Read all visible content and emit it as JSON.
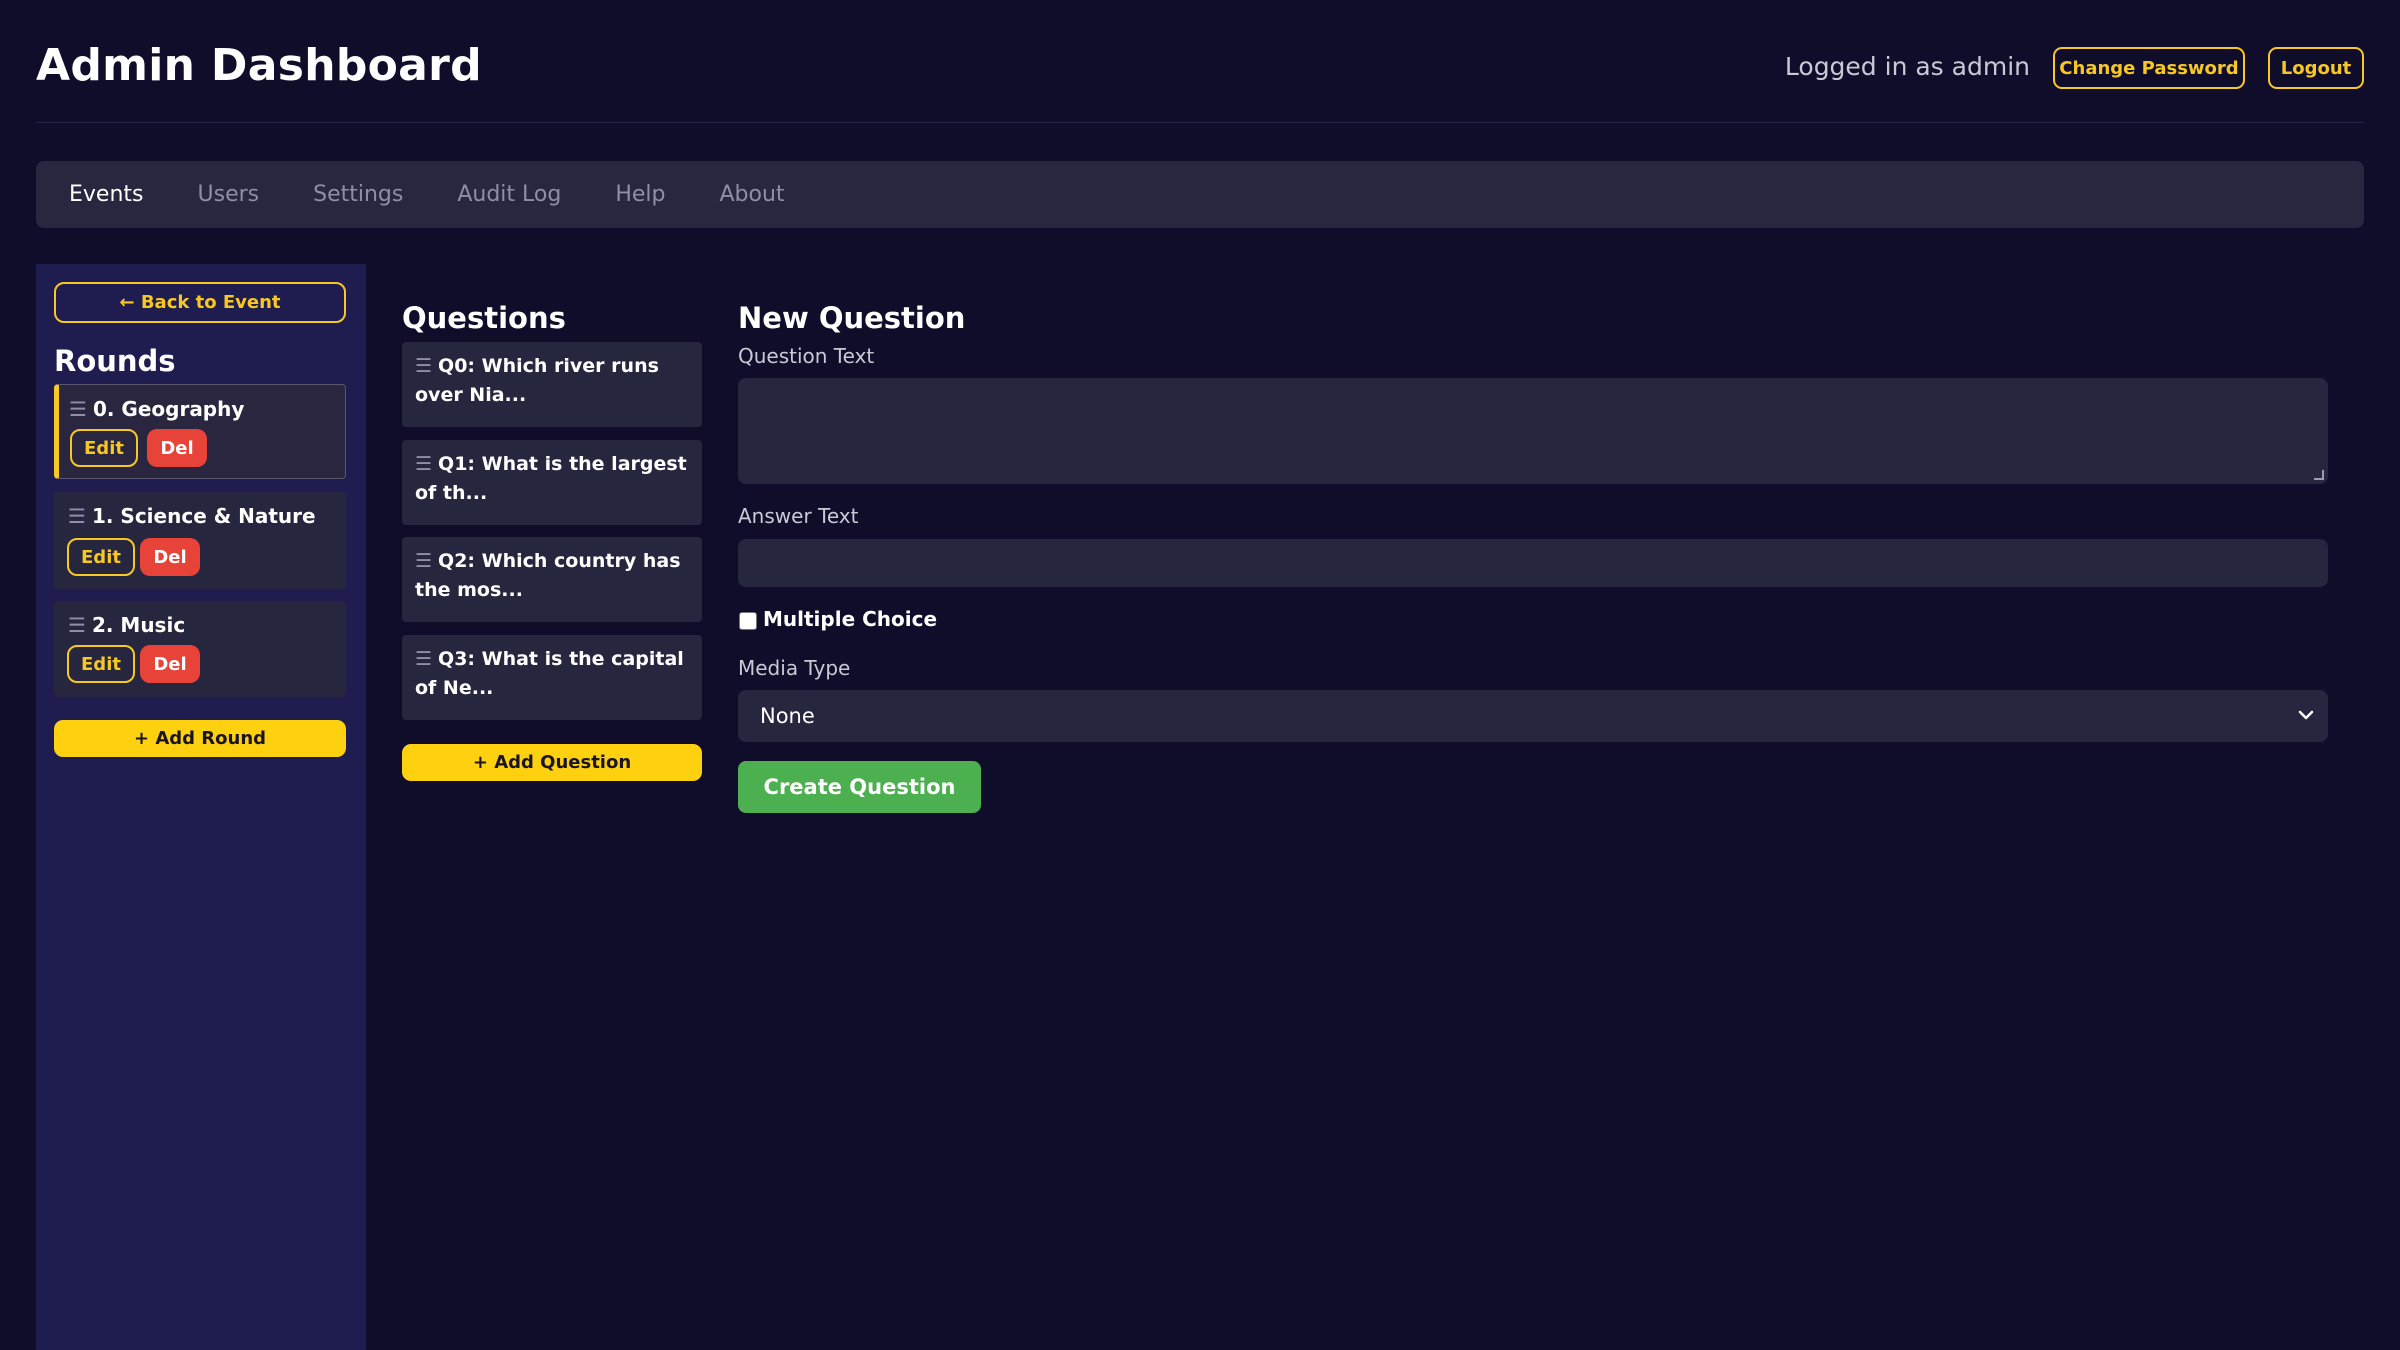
{
  "header": {
    "title": "Admin Dashboard",
    "logged_in_text": "Logged in as admin",
    "change_password_label": "Change Password",
    "logout_label": "Logout"
  },
  "nav": {
    "tabs": [
      {
        "label": "Events",
        "active": true
      },
      {
        "label": "Users",
        "active": false
      },
      {
        "label": "Settings",
        "active": false
      },
      {
        "label": "Audit Log",
        "active": false
      },
      {
        "label": "Help",
        "active": false
      },
      {
        "label": "About",
        "active": false
      }
    ]
  },
  "sidebar": {
    "back_label": "← Back to Event",
    "rounds_heading": "Rounds",
    "rounds": [
      {
        "label": "0. Geography",
        "active": true,
        "edit_label": "Edit",
        "del_label": "Del"
      },
      {
        "label": "1. Science & Nature",
        "active": false,
        "edit_label": "Edit",
        "del_label": "Del"
      },
      {
        "label": "2. Music",
        "active": false,
        "edit_label": "Edit",
        "del_label": "Del"
      }
    ],
    "add_round_label": "+ Add Round"
  },
  "questions": {
    "heading": "Questions",
    "items": [
      {
        "label": "Q0: Which river runs over Nia..."
      },
      {
        "label": "Q1: What is the largest of th..."
      },
      {
        "label": "Q2: Which country has the mos..."
      },
      {
        "label": "Q3: What is the capital of Ne..."
      }
    ],
    "add_question_label": "+ Add Question"
  },
  "form": {
    "heading": "New Question",
    "question_text_label": "Question Text",
    "question_text_value": "",
    "answer_text_label": "Answer Text",
    "answer_text_value": "",
    "multiple_choice_label": "Multiple Choice",
    "multiple_choice_checked": false,
    "media_type_label": "Media Type",
    "media_type_value": "None",
    "create_label": "Create Question"
  },
  "colors": {
    "background": "#100d2b",
    "accent_yellow": "#f7c824",
    "danger_red": "#e84338",
    "success_green": "#4caf50",
    "panel": "#27263f",
    "sidebar": "#1f1c4f"
  },
  "icons": {
    "drag_handle": "drag-handle-icon",
    "select_chevron": "chevron-down-icon"
  }
}
